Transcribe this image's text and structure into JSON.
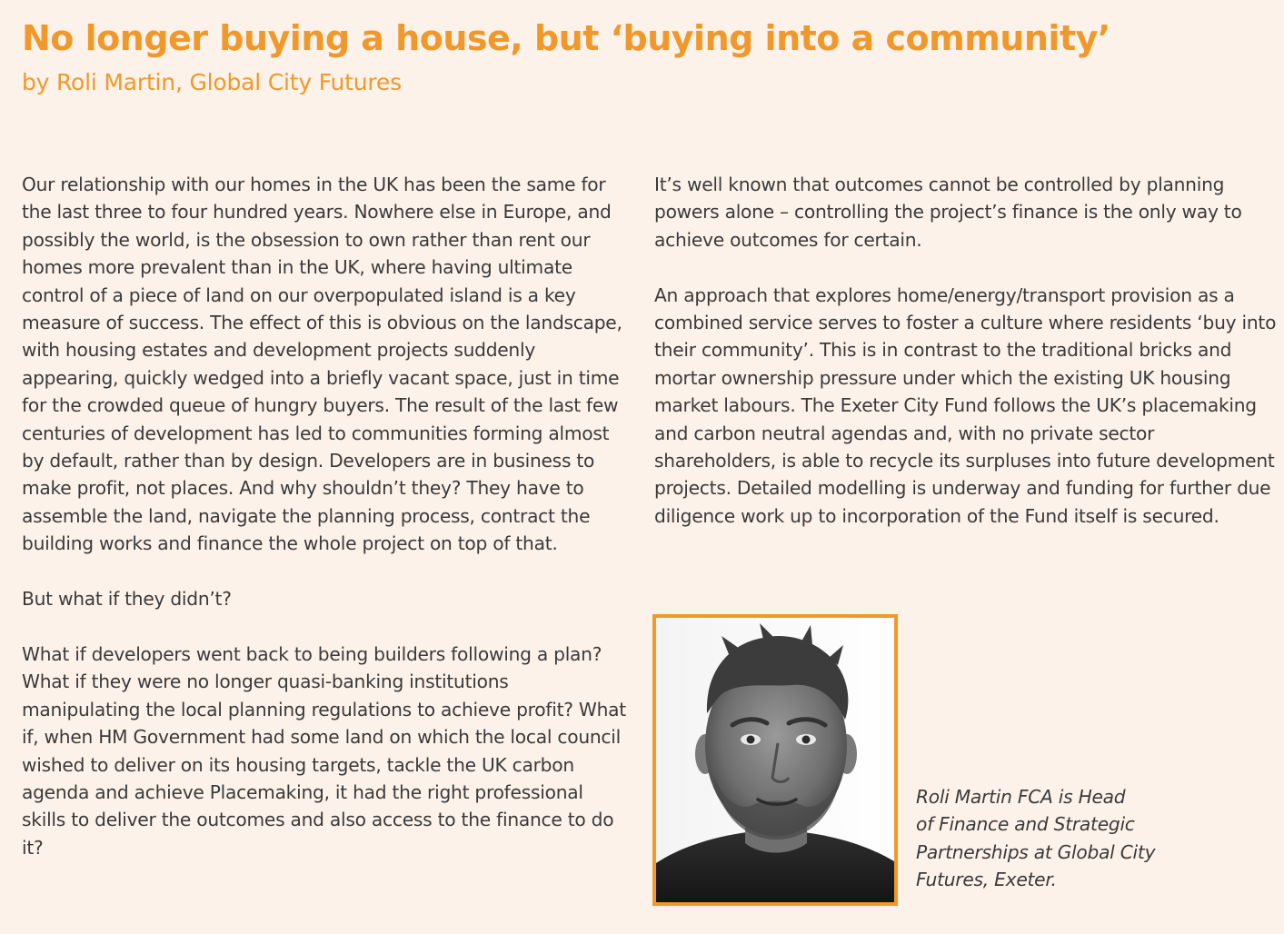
{
  "article": {
    "title": "No longer buying a house, but ‘buying into a community’",
    "byline": "by Roli Martin, Global City Futures"
  },
  "left_column": {
    "paragraphs": [
      "Our relationship with our homes in the UK has been the same for the last three to four hundred years. Nowhere else in Europe, and possibly the world, is the obsession to own rather than rent our homes more prevalent than in the UK, where having ultimate control of a piece of land on our overpopulated island is a key measure of success. The effect of this is obvious on the landscape, with housing estates and development projects suddenly appearing, quickly wedged into a briefly vacant space, just in time for the crowded queue of hungry buyers. The result of the last few centuries of development has led to communities forming almost by default, rather than by design. Developers are in business to make profit, not places. And why shouldn’t they? They have to assemble the land, navigate the planning process, contract the building works and finance the whole project on top of that.",
      "But what if they didn’t?",
      "What if developers went back to being builders following a plan? What if they were no longer quasi-banking institutions manipulating the local planning regulations to achieve profit? What if, when HM Government had some land on which the local council wished to deliver on its housing targets, tackle the UK carbon agenda and achieve Placemaking, it had the right professional skills to deliver the outcomes and also access to the finance to do it?"
    ]
  },
  "right_column": {
    "paragraphs": [
      "It’s well known that outcomes cannot be controlled by planning powers alone – controlling the project’s finance is the only way to achieve outcomes for certain.",
      "An approach that explores home/energy/transport provision as a combined service serves to foster a culture where residents ‘buy into their community’. This is in contrast to the traditional bricks and mortar ownership pressure under which the existing UK housing market labours. The Exeter City Fund follows the UK’s placemaking and carbon neutral agendas and, with no private sector shareholders, is able to recycle its surpluses into future development projects. Detailed modelling is underway and funding for further due diligence work up to incorporation of the Fund itself is secured."
    ]
  },
  "author": {
    "caption_lines": [
      "Roli Martin FCA is Head",
      "of Finance and Strategic",
      "Partnerships at Global City",
      "Futures, Exeter."
    ]
  },
  "colors": {
    "accent": "#f0982a",
    "background": "#fdf2ea",
    "text": "#3a3a3a"
  }
}
